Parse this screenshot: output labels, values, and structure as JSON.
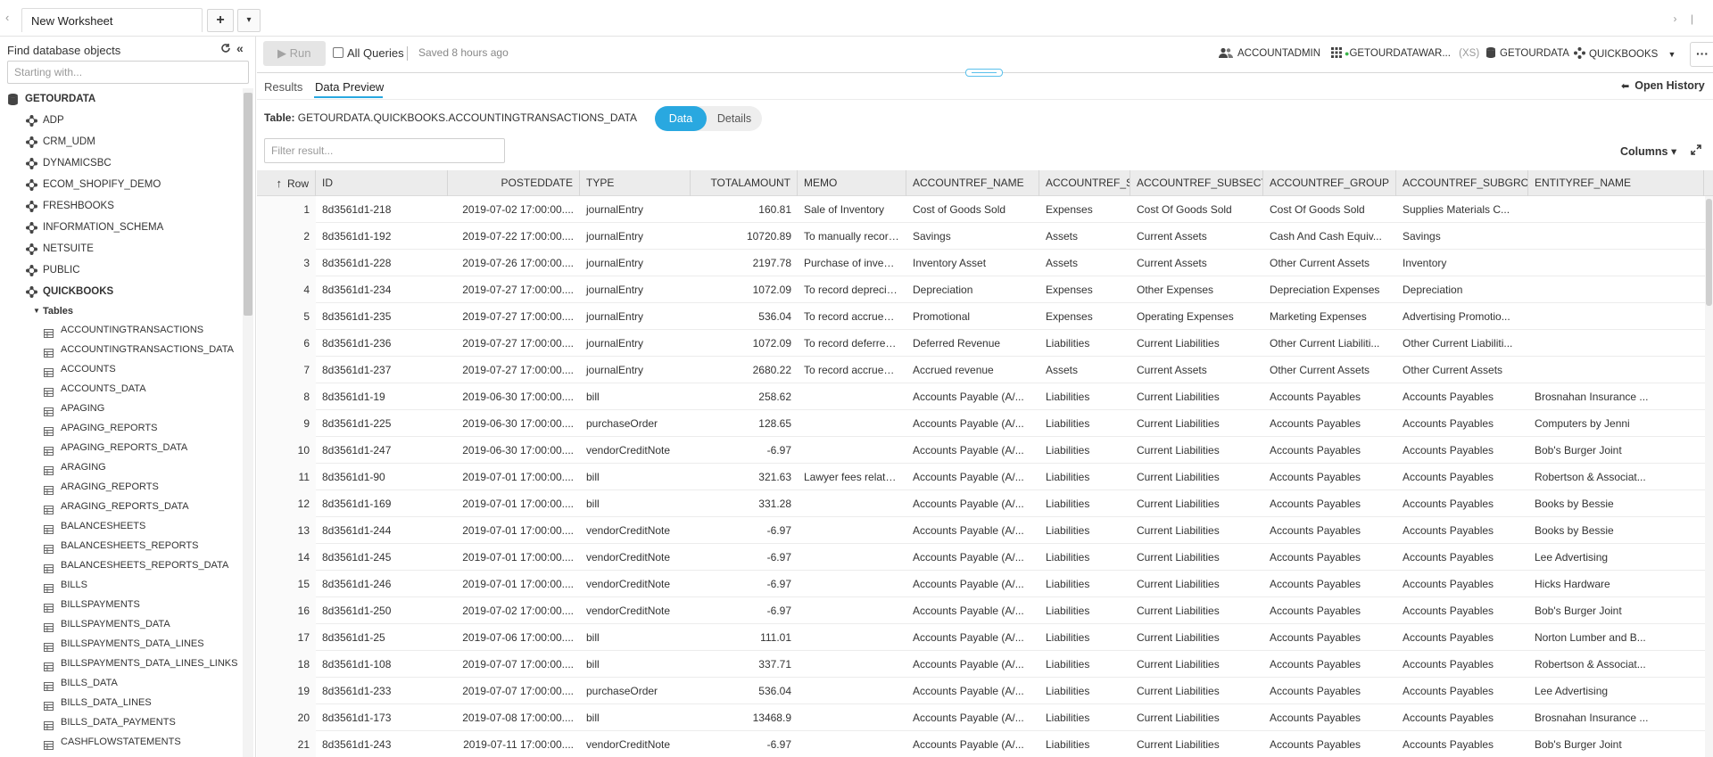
{
  "tabs": {
    "worksheet": "New Worksheet",
    "add": "+",
    "dropdown": "▾",
    "back": "‹",
    "right": "› |"
  },
  "sidebar": {
    "title": "Find database objects",
    "search_placeholder": "Starting with...",
    "database": "GETOURDATA",
    "schemas": [
      "ADP",
      "CRM_UDM",
      "DYNAMICSBC",
      "ECOM_SHOPIFY_DEMO",
      "FRESHBOOKS",
      "INFORMATION_SCHEMA",
      "NETSUITE",
      "PUBLIC"
    ],
    "open_schema": "QUICKBOOKS",
    "group": "Tables",
    "tables": [
      "ACCOUNTINGTRANSACTIONS",
      "ACCOUNTINGTRANSACTIONS_DATA",
      "ACCOUNTS",
      "ACCOUNTS_DATA",
      "APAGING",
      "APAGING_REPORTS",
      "APAGING_REPORTS_DATA",
      "ARAGING",
      "ARAGING_REPORTS",
      "ARAGING_REPORTS_DATA",
      "BALANCESHEETS",
      "BALANCESHEETS_REPORTS",
      "BALANCESHEETS_REPORTS_DATA",
      "BILLS",
      "BILLSPAYMENTS",
      "BILLSPAYMENTS_DATA",
      "BILLSPAYMENTS_DATA_LINES",
      "BILLSPAYMENTS_DATA_LINES_LINKS",
      "BILLS_DATA",
      "BILLS_DATA_LINES",
      "BILLS_DATA_PAYMENTS",
      "CASHFLOWSTATEMENTS"
    ]
  },
  "toolbar": {
    "run": "▶ Run",
    "all_queries": "All Queries",
    "saved": "Saved 8 hours ago",
    "role": "ACCOUNTADMIN",
    "warehouse": "GETOURDATAWAR...",
    "warehouse_size": "(XS)",
    "database": "GETOURDATA",
    "schema": "QUICKBOOKS",
    "more": "···"
  },
  "result_tabs": {
    "results": "Results",
    "data_preview": "Data Preview",
    "open_history": "Open History"
  },
  "preview": {
    "table_label": "Table:",
    "table_name": "GETOURDATA.QUICKBOOKS.ACCOUNTINGTRANSACTIONS_DATA",
    "toggle_data": "Data",
    "toggle_details": "Details",
    "filter_placeholder": "Filter result...",
    "columns_label": "Columns ▾"
  },
  "grid": {
    "columns": [
      "Row",
      "ID",
      "POSTEDDATE",
      "TYPE",
      "TOTALAMOUNT",
      "MEMO",
      "ACCOUNTREF_NAME",
      "ACCOUNTREF_S",
      "ACCOUNTREF_SUBSECT",
      "ACCOUNTREF_GROUP",
      "ACCOUNTREF_SUBGROI",
      "ENTITYREF_NAME"
    ],
    "rows": [
      [
        "1",
        "8d3561d1-218",
        "2019-07-02 17:00:00....",
        "journalEntry",
        "160.81",
        "Sale of Inventory",
        "Cost of Goods Sold",
        "Expenses",
        "Cost Of Goods Sold",
        "Cost Of Goods Sold",
        "Supplies Materials C...",
        ""
      ],
      [
        "2",
        "8d3561d1-192",
        "2019-07-22 17:00:00....",
        "journalEntry",
        "10720.89",
        "To manually record s...",
        "Savings",
        "Assets",
        "Current Assets",
        "Cash And Cash Equiv...",
        "Savings",
        ""
      ],
      [
        "3",
        "8d3561d1-228",
        "2019-07-26 17:00:00....",
        "journalEntry",
        "2197.78",
        "Purchase of inventory",
        "Inventory Asset",
        "Assets",
        "Current Assets",
        "Other Current Assets",
        "Inventory",
        ""
      ],
      [
        "4",
        "8d3561d1-234",
        "2019-07-27 17:00:00....",
        "journalEntry",
        "1072.09",
        "To record depreciatio...",
        "Depreciation",
        "Expenses",
        "Other Expenses",
        "Depreciation Expenses",
        "Depreciation",
        ""
      ],
      [
        "5",
        "8d3561d1-235",
        "2019-07-27 17:00:00....",
        "journalEntry",
        "536.04",
        "To record accrued lia...",
        "Promotional",
        "Expenses",
        "Operating Expenses",
        "Marketing Expenses",
        "Advertising Promotio...",
        ""
      ],
      [
        "6",
        "8d3561d1-236",
        "2019-07-27 17:00:00....",
        "journalEntry",
        "1072.09",
        "To record deferred re...",
        "Deferred Revenue",
        "Liabilities",
        "Current Liabilities",
        "Other Current Liabiliti...",
        "Other Current Liabiliti...",
        ""
      ],
      [
        "7",
        "8d3561d1-237",
        "2019-07-27 17:00:00....",
        "journalEntry",
        "2680.22",
        "To record accrued re...",
        "Accrued revenue",
        "Assets",
        "Current Assets",
        "Other Current Assets",
        "Other Current Assets",
        ""
      ],
      [
        "8",
        "8d3561d1-19",
        "2019-06-30 17:00:00....",
        "bill",
        "258.62",
        "",
        "Accounts Payable (A/...",
        "Liabilities",
        "Current Liabilities",
        "Accounts Payables",
        "Accounts Payables",
        "Brosnahan Insurance ..."
      ],
      [
        "9",
        "8d3561d1-225",
        "2019-06-30 17:00:00....",
        "purchaseOrder",
        "128.65",
        "",
        "Accounts Payable (A/...",
        "Liabilities",
        "Current Liabilities",
        "Accounts Payables",
        "Accounts Payables",
        "Computers by Jenni"
      ],
      [
        "10",
        "8d3561d1-247",
        "2019-06-30 17:00:00....",
        "vendorCreditNote",
        "-6.97",
        "",
        "Accounts Payable (A/...",
        "Liabilities",
        "Current Liabilities",
        "Accounts Payables",
        "Accounts Payables",
        "Bob's Burger Joint"
      ],
      [
        "11",
        "8d3561d1-90",
        "2019-07-01 17:00:00....",
        "bill",
        "321.63",
        "Lawyer fees related t...",
        "Accounts Payable (A/...",
        "Liabilities",
        "Current Liabilities",
        "Accounts Payables",
        "Accounts Payables",
        "Robertson & Associat..."
      ],
      [
        "12",
        "8d3561d1-169",
        "2019-07-01 17:00:00....",
        "bill",
        "331.28",
        "",
        "Accounts Payable (A/...",
        "Liabilities",
        "Current Liabilities",
        "Accounts Payables",
        "Accounts Payables",
        "Books by Bessie"
      ],
      [
        "13",
        "8d3561d1-244",
        "2019-07-01 17:00:00....",
        "vendorCreditNote",
        "-6.97",
        "",
        "Accounts Payable (A/...",
        "Liabilities",
        "Current Liabilities",
        "Accounts Payables",
        "Accounts Payables",
        "Books by Bessie"
      ],
      [
        "14",
        "8d3561d1-245",
        "2019-07-01 17:00:00....",
        "vendorCreditNote",
        "-6.97",
        "",
        "Accounts Payable (A/...",
        "Liabilities",
        "Current Liabilities",
        "Accounts Payables",
        "Accounts Payables",
        "Lee Advertising"
      ],
      [
        "15",
        "8d3561d1-246",
        "2019-07-01 17:00:00....",
        "vendorCreditNote",
        "-6.97",
        "",
        "Accounts Payable (A/...",
        "Liabilities",
        "Current Liabilities",
        "Accounts Payables",
        "Accounts Payables",
        "Hicks Hardware"
      ],
      [
        "16",
        "8d3561d1-250",
        "2019-07-02 17:00:00....",
        "vendorCreditNote",
        "-6.97",
        "",
        "Accounts Payable (A/...",
        "Liabilities",
        "Current Liabilities",
        "Accounts Payables",
        "Accounts Payables",
        "Bob's Burger Joint"
      ],
      [
        "17",
        "8d3561d1-25",
        "2019-07-06 17:00:00....",
        "bill",
        "111.01",
        "",
        "Accounts Payable (A/...",
        "Liabilities",
        "Current Liabilities",
        "Accounts Payables",
        "Accounts Payables",
        "Norton Lumber and B..."
      ],
      [
        "18",
        "8d3561d1-108",
        "2019-07-07 17:00:00....",
        "bill",
        "337.71",
        "",
        "Accounts Payable (A/...",
        "Liabilities",
        "Current Liabilities",
        "Accounts Payables",
        "Accounts Payables",
        "Robertson & Associat..."
      ],
      [
        "19",
        "8d3561d1-233",
        "2019-07-07 17:00:00....",
        "purchaseOrder",
        "536.04",
        "",
        "Accounts Payable (A/...",
        "Liabilities",
        "Current Liabilities",
        "Accounts Payables",
        "Accounts Payables",
        "Lee Advertising"
      ],
      [
        "20",
        "8d3561d1-173",
        "2019-07-08 17:00:00....",
        "bill",
        "13468.9",
        "",
        "Accounts Payable (A/...",
        "Liabilities",
        "Current Liabilities",
        "Accounts Payables",
        "Accounts Payables",
        "Brosnahan Insurance ..."
      ],
      [
        "21",
        "8d3561d1-243",
        "2019-07-11 17:00:00....",
        "vendorCreditNote",
        "-6.97",
        "",
        "Accounts Payable (A/...",
        "Liabilities",
        "Current Liabilities",
        "Accounts Payables",
        "Accounts Payables",
        "Bob's Burger Joint"
      ]
    ]
  },
  "colors": {
    "accent": "#29a8e0",
    "status_green": "#3bb34a",
    "header_bg": "#ececec"
  },
  "icons": [
    "back-icon",
    "plus-icon",
    "dropdown-icon",
    "refresh-icon",
    "collapse-icon",
    "database-icon",
    "schema-icon",
    "table-icon",
    "play-icon",
    "role-icon",
    "warehouse-icon",
    "ellipsis-icon",
    "arrow-left-icon",
    "expand-icon",
    "sort-asc-icon"
  ]
}
